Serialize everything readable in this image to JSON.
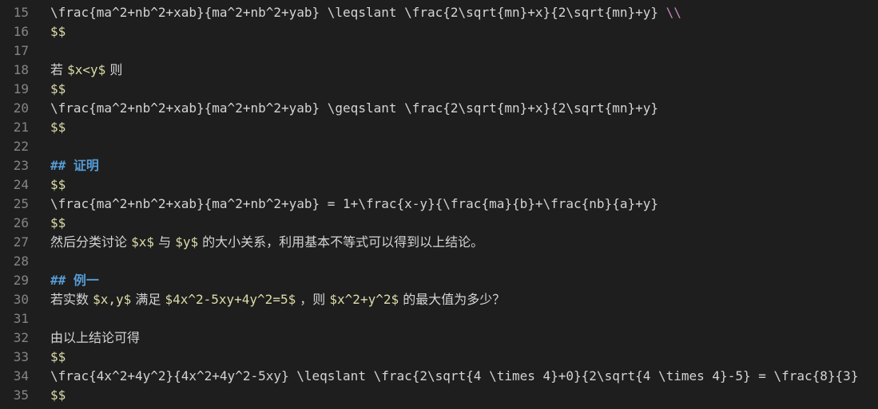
{
  "editor": {
    "lines": [
      {
        "num": "15",
        "segments": [
          {
            "t": "\\frac{ma^2+nb^2+xab}{ma^2+nb^2+yab} \\leqslant \\frac{2\\sqrt{mn}+x}{2\\sqrt{mn}+y} ",
            "k": "plain"
          },
          {
            "t": "\\\\",
            "k": "dbl"
          }
        ]
      },
      {
        "num": "16",
        "segments": [
          {
            "t": "$$",
            "k": "math"
          }
        ]
      },
      {
        "num": "17",
        "segments": []
      },
      {
        "num": "18",
        "segments": [
          {
            "t": "若 ",
            "k": "cjk"
          },
          {
            "t": "$x<y$",
            "k": "math"
          },
          {
            "t": " 则",
            "k": "cjk"
          }
        ]
      },
      {
        "num": "19",
        "segments": [
          {
            "t": "$$",
            "k": "math"
          }
        ]
      },
      {
        "num": "20",
        "segments": [
          {
            "t": "\\frac{ma^2+nb^2+xab}{ma^2+nb^2+yab} \\geqslant \\frac{2\\sqrt{mn}+x}{2\\sqrt{mn}+y}",
            "k": "plain"
          }
        ]
      },
      {
        "num": "21",
        "segments": [
          {
            "t": "$$",
            "k": "math"
          }
        ]
      },
      {
        "num": "22",
        "segments": []
      },
      {
        "num": "23",
        "segments": [
          {
            "t": "## ",
            "k": "hmark"
          },
          {
            "t": "证明",
            "k": "htext"
          }
        ]
      },
      {
        "num": "24",
        "segments": [
          {
            "t": "$$",
            "k": "math"
          }
        ]
      },
      {
        "num": "25",
        "segments": [
          {
            "t": "\\frac{ma^2+nb^2+xab}{ma^2+nb^2+yab} = 1+\\frac{x-y}{\\frac{ma}{b}+\\frac{nb}{a}+y}",
            "k": "plain"
          }
        ]
      },
      {
        "num": "26",
        "segments": [
          {
            "t": "$$",
            "k": "math"
          }
        ]
      },
      {
        "num": "27",
        "segments": [
          {
            "t": "然后分类讨论 ",
            "k": "cjk"
          },
          {
            "t": "$x$",
            "k": "math"
          },
          {
            "t": " 与 ",
            "k": "cjk"
          },
          {
            "t": "$y$",
            "k": "math"
          },
          {
            "t": " 的大小关系，利用基本不等式可以得到以上结论。",
            "k": "cjk"
          }
        ]
      },
      {
        "num": "28",
        "segments": []
      },
      {
        "num": "29",
        "segments": [
          {
            "t": "## ",
            "k": "hmark"
          },
          {
            "t": "例一",
            "k": "htext"
          }
        ]
      },
      {
        "num": "30",
        "segments": [
          {
            "t": "若实数 ",
            "k": "cjk"
          },
          {
            "t": "$x,y$",
            "k": "math"
          },
          {
            "t": " 满足 ",
            "k": "cjk"
          },
          {
            "t": "$4x^2-5xy+4y^2=5$",
            "k": "math"
          },
          {
            "t": " ，则 ",
            "k": "cjk"
          },
          {
            "t": "$x^2+y^2$",
            "k": "math"
          },
          {
            "t": " 的最大值为多少？",
            "k": "cjk"
          }
        ]
      },
      {
        "num": "31",
        "segments": []
      },
      {
        "num": "32",
        "segments": [
          {
            "t": "由以上结论可得",
            "k": "cjk"
          }
        ]
      },
      {
        "num": "33",
        "segments": [
          {
            "t": "$$",
            "k": "math"
          }
        ]
      },
      {
        "num": "34",
        "segments": [
          {
            "t": "\\frac{4x^2+4y^2}{4x^2+4y^2-5xy} \\leqslant \\frac{2\\sqrt{4 \\times 4}+0}{2\\sqrt{4 \\times 4}-5} = \\frac{8}{3}",
            "k": "plain"
          }
        ]
      },
      {
        "num": "35",
        "segments": [
          {
            "t": "$$",
            "k": "math"
          }
        ]
      }
    ]
  }
}
